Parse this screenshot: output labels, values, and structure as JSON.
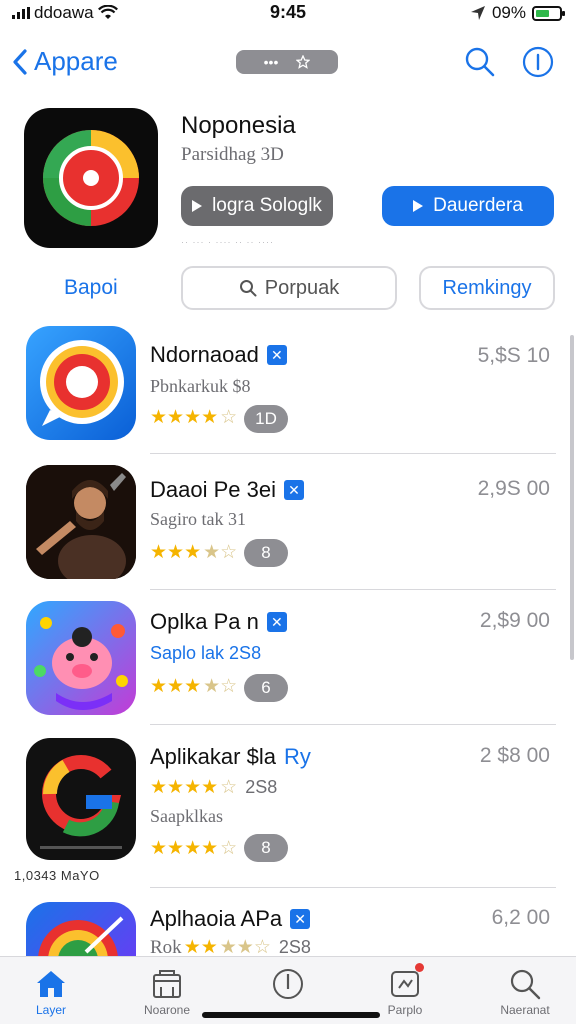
{
  "status_bar": {
    "carrier": "ddoawa",
    "time": "9:45",
    "battery": "09%"
  },
  "nav": {
    "back_label": "Appare",
    "pill_text": "•••"
  },
  "featured": {
    "title": "Noponesia",
    "subtitle": "Parsidhag 3D",
    "primary_button": "logra Sologlk",
    "secondary_button": "Dauerdera",
    "fine_print": "·· ··· · ···· ·· ·· ····"
  },
  "segments": {
    "left_label": "Bapoi",
    "search_placeholder": "Porpuak",
    "right_label": "Remkingy"
  },
  "apps": [
    {
      "name": "Ndornaoad",
      "price": "5,$S 10",
      "subtitle": "Pbnkarkuk $8",
      "rating": 4.5,
      "count": "1D"
    },
    {
      "name": "Daaoi Pe 3ei",
      "price": "2,9S 00",
      "subtitle": "Sagiro tak 31",
      "rating": 3.5,
      "count": "8"
    },
    {
      "name": "Oplka Pa n",
      "price": "2,$9 00",
      "subtitle": "Saplo lak 2S8",
      "rating": 3.5,
      "count": "6"
    },
    {
      "name": "Aplikakar $la",
      "name_accent": "Ry",
      "price": "2 $8 00",
      "stars_text": "2S8",
      "subtitle": "Saapklkas",
      "rating": 4.5,
      "count": "8",
      "caption": "1,0343 MaYO"
    },
    {
      "name": "Aplhaoia APa",
      "price": "6,2 00",
      "subtitle": "Rok",
      "stars_text": "2S8",
      "rating": 2.5
    }
  ],
  "tabs": [
    {
      "label": "Layer",
      "icon": "home-icon",
      "active": true
    },
    {
      "label": "Noarone",
      "icon": "store-icon",
      "active": false
    },
    {
      "label": "",
      "icon": "compass-icon",
      "active": false
    },
    {
      "label": "Parplo",
      "icon": "updates-icon",
      "active": false
    },
    {
      "label": "Naeranat",
      "icon": "search-icon",
      "active": false
    }
  ],
  "colors": {
    "accent": "#1a73e8",
    "star": "#f5b400",
    "gray_button": "#6b6b6e"
  }
}
